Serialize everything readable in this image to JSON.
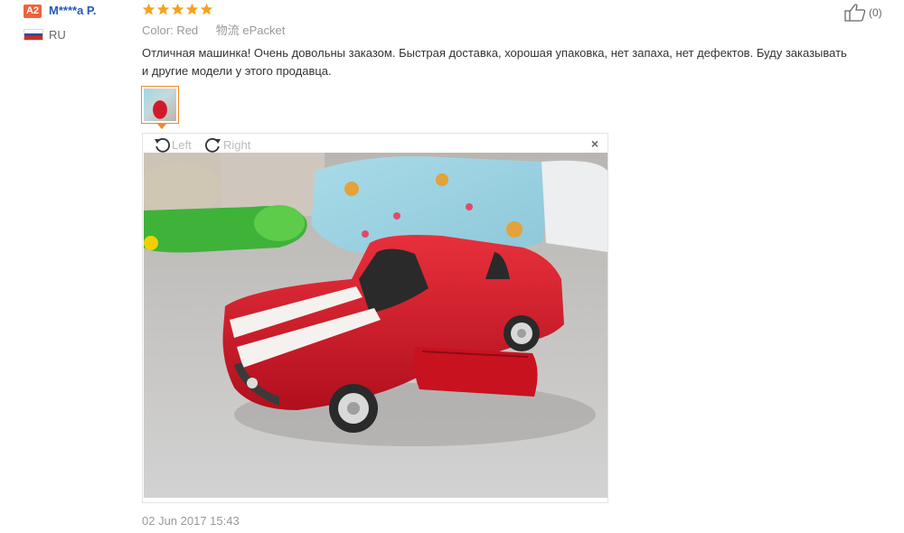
{
  "user": {
    "badge": "A2",
    "name": "M****a P.",
    "country_code": "RU"
  },
  "review": {
    "rating": 5,
    "rating_max": 5,
    "color_label": "Color:",
    "color_value": "Red",
    "shipping": "物流 ePacket",
    "text": "Отличная машинка! Очень довольны заказом. Быстрая доставка, хорошая упаковка, нет запаха, нет дефектов. Буду заказывать и другие модели у этого продавца.",
    "date": "02 Jun 2017 15:43"
  },
  "helpful": {
    "count": "(0)"
  },
  "viewer": {
    "rotate_left_label": "Left",
    "rotate_right_label": "Right",
    "close_label": "×"
  },
  "icons": {
    "star": "star-icon",
    "thumbs_up": "thumbs-up-icon",
    "rotate_left": "rotate-left-icon",
    "rotate_right": "rotate-right-icon",
    "close": "close-icon"
  },
  "colors": {
    "star": "#f7a21b",
    "user_name": "#1e5bb8",
    "badge": "#f0613c",
    "thumb_border": "#f08a24",
    "car_red": "#d11a2a"
  }
}
